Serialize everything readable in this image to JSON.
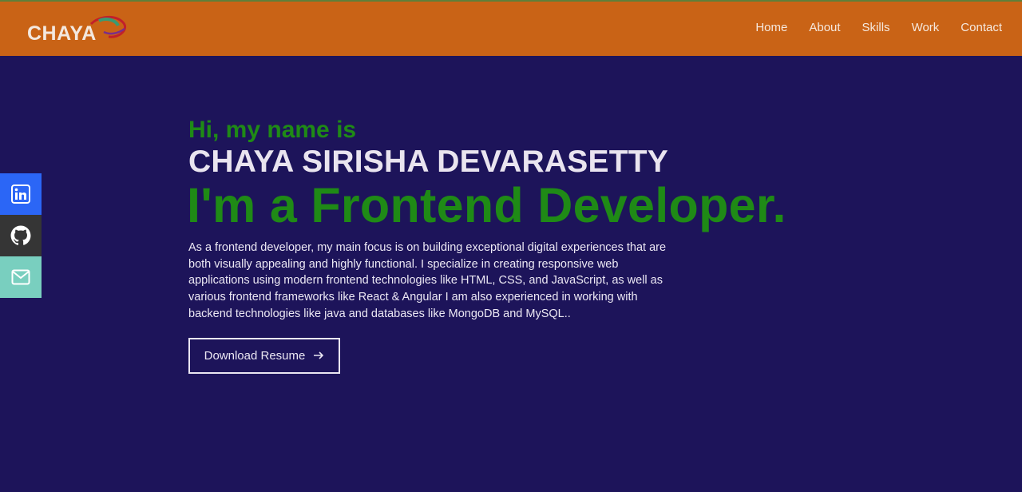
{
  "header": {
    "logo_text": "CHAYA",
    "nav": [
      {
        "label": "Home"
      },
      {
        "label": "About"
      },
      {
        "label": "Skills"
      },
      {
        "label": "Work"
      },
      {
        "label": "Contact"
      }
    ]
  },
  "social": [
    {
      "icon": "linkedin-icon",
      "color": "#2b66f6"
    },
    {
      "icon": "github-icon",
      "color": "#353535"
    },
    {
      "icon": "email-icon",
      "color": "#79cfbf"
    }
  ],
  "hero": {
    "greeting": "Hi, my name is",
    "name": "CHAYA SIRISHA DEVARASETTY",
    "role": "I'm a Frontend Developer.",
    "bio": "As a frontend developer, my main focus is on building exceptional digital experiences that are both visually appealing and highly functional. I specialize in creating responsive web applications using modern frontend technologies like HTML, CSS, and JavaScript, as well as various frontend frameworks like React & Angular I am also experienced in working with backend technologies like java and databases like MongoDB and MySQL..",
    "button_label": "Download Resume",
    "button_icon": "arrow-right-icon"
  },
  "colors": {
    "header_bg": "#c96316",
    "page_bg": "#1d145a",
    "accent_green": "#1f8a16",
    "text_light": "#e9e4ef"
  }
}
